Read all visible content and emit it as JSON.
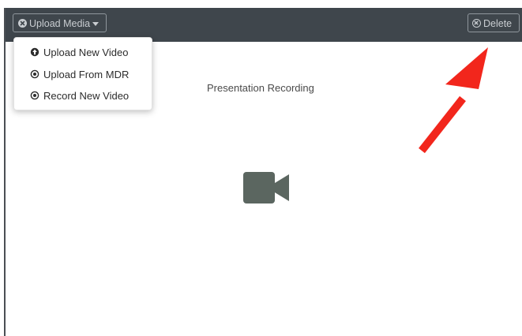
{
  "toolbar": {
    "upload_label": "Upload Media",
    "delete_label": "Delete"
  },
  "upload_menu": {
    "items": [
      {
        "label": "Upload New Video",
        "icon": "circle-up-arrow-icon"
      },
      {
        "label": "Upload From MDR",
        "icon": "radio-dot-icon"
      },
      {
        "label": "Record New Video",
        "icon": "radio-dot-icon"
      }
    ]
  },
  "main": {
    "title": "Presentation Recording",
    "placeholder_icon": "video-camera-icon"
  },
  "annotation": {
    "arrow_color": "#f2261c"
  },
  "colors": {
    "topbar": "#3f464c",
    "camera": "#5b6660"
  }
}
